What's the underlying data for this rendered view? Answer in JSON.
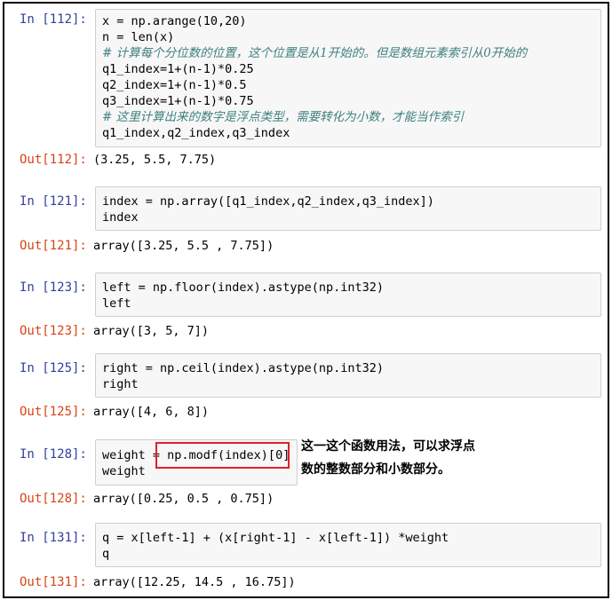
{
  "cells": [
    {
      "in_prompt": "In  [112]:",
      "out_prompt": "Out[112]:",
      "lines": [
        "x = np.arange(10,20)",
        "n = len(x)",
        "# 计算每个分位数的位置，这个位置是从1开始的。但是数组元素索引从0开始的",
        "q1_index=1+(n-1)*0.25",
        "q2_index=1+(n-1)*0.5",
        "q3_index=1+(n-1)*0.75",
        "# 这里计算出来的数字是浮点类型，需要转化为小数，才能当作索引",
        "q1_index,q2_index,q3_index"
      ],
      "output": "(3.25, 5.5, 7.75)"
    },
    {
      "in_prompt": "In  [121]:",
      "out_prompt": "Out[121]:",
      "lines": [
        "index = np.array([q1_index,q2_index,q3_index])",
        "index"
      ],
      "output": "array([3.25, 5.5 , 7.75])"
    },
    {
      "in_prompt": "In  [123]:",
      "out_prompt": "Out[123]:",
      "lines": [
        "left = np.floor(index).astype(np.int32)",
        "left"
      ],
      "output": "array([3, 5, 7])"
    },
    {
      "in_prompt": "In  [125]:",
      "out_prompt": "Out[125]:",
      "lines": [
        "right = np.ceil(index).astype(np.int32)",
        "right"
      ],
      "output": "array([4, 6, 8])"
    },
    {
      "in_prompt": "In  [128]:",
      "out_prompt": "Out[128]:",
      "lines": [
        "weight = np.modf(index)[0]",
        "weight"
      ],
      "output": "array([0.25, 0.5 , 0.75])"
    },
    {
      "in_prompt": "In  [131]:",
      "out_prompt": "Out[131]:",
      "lines": [
        "q = x[left-1] + (x[right-1] - x[left-1]) *weight",
        "q"
      ],
      "output": "array([12.25, 14.5 , 16.75])"
    }
  ],
  "annotation": {
    "line1": "这一这个函数用法，可以求浮点",
    "line2": "数的整数部分和小数部分。"
  },
  "colors": {
    "in_prompt": "#303f9f",
    "out_prompt": "#d84315",
    "highlight": "#e0202a"
  }
}
